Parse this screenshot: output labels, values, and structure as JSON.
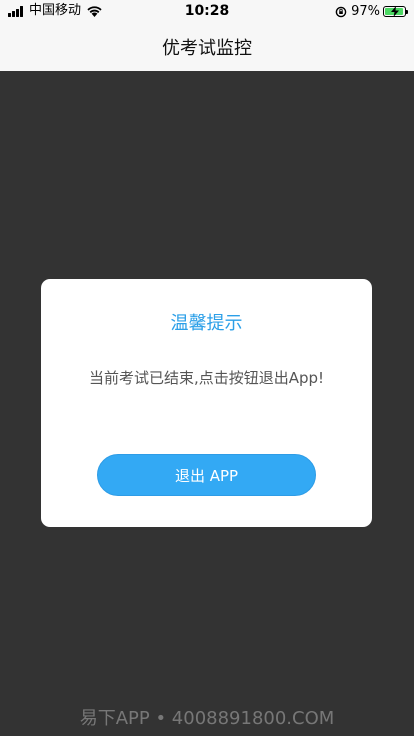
{
  "status_bar": {
    "carrier": "中国移动",
    "time": "10:28",
    "battery_percent": "97%",
    "battery_level": 0.97
  },
  "nav": {
    "title": "优考试监控"
  },
  "dialog": {
    "title": "温馨提示",
    "message": "当前考试已结束,点击按钮退出App!",
    "button_label": "退出 APP"
  },
  "watermark": "易下APP • 4008891800.COM",
  "colors": {
    "accent": "#33a9f4",
    "title_blue": "#2b9fe8",
    "overlay": "#333333"
  }
}
